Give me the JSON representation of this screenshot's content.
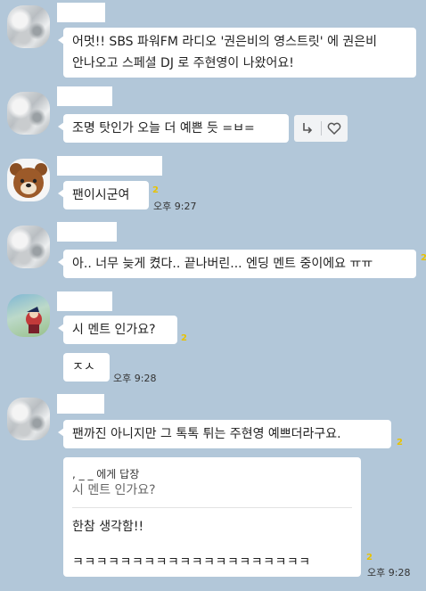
{
  "messages": [
    {
      "text1": "어멋!! SBS 파워FM 라디오 '권은비의 영스트릿' 에 권은비",
      "text2": "안나오고 스페셜 DJ 로 주현영이 나왔어요!"
    },
    {
      "text": "조명 탓인가 오늘 더 예쁜 듯 =ㅂ="
    },
    {
      "text": "팬이시군여",
      "unread": "2",
      "time": "오후 9:27"
    },
    {
      "text": "아.. 너무 늦게 켰다.. 끝나버린... 엔딩 멘트 중이에요 ㅠㅠ",
      "unread": "2"
    },
    {
      "text": "시 멘트 인가요?",
      "unread": "2"
    },
    {
      "text": "ㅈㅅ",
      "time": "오후 9:28"
    },
    {
      "text": "팬까진 아니지만 그 톡톡 튀는 주현영 예쁘더라구요.",
      "unread": "2"
    },
    {
      "reply_to": ", _ _ 에게 답장",
      "quote": "시 멘트 인가요?",
      "text": "한참 생각함!!",
      "laugh": "ㅋㅋㅋㅋㅋㅋㅋㅋㅋㅋㅋㅋㅋㅋㅋㅋㅋㅋㅋㅋ",
      "unread": "2",
      "time": "오후 9:28"
    }
  ],
  "icons": {
    "reply": "reply-arrow-icon",
    "like": "heart-icon"
  }
}
